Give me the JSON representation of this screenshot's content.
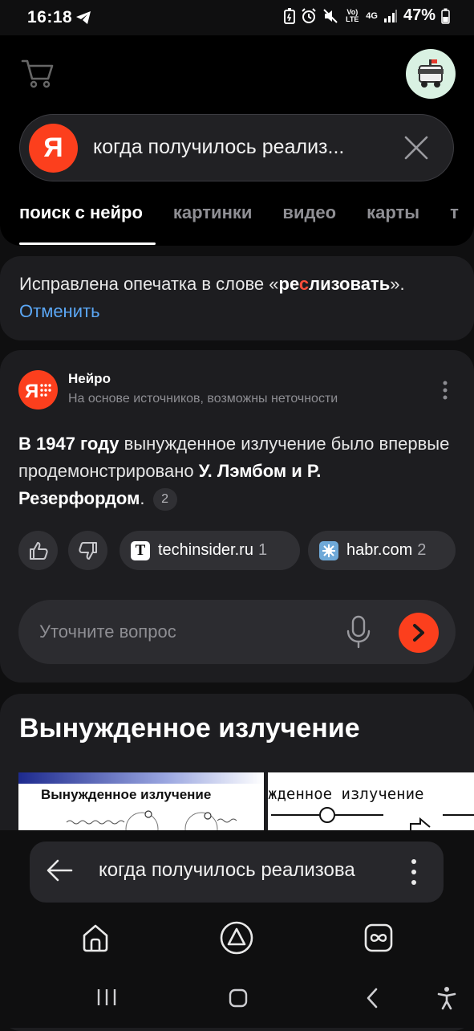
{
  "status_bar": {
    "time": "16:18",
    "battery": "47%",
    "network": "4G",
    "volte": "Vo) LTE"
  },
  "search": {
    "logo": "Я",
    "query": "когда получилось реализ..."
  },
  "tabs": [
    {
      "label": "поиск с нейро",
      "active": true
    },
    {
      "label": "картинки"
    },
    {
      "label": "видео"
    },
    {
      "label": "карты"
    },
    {
      "label": "т"
    }
  ],
  "correction": {
    "prefix": "Исправлена опечатка в слове «",
    "word_part1": "ре",
    "word_hl": "с",
    "word_part2": "лизовать",
    "suffix": "».",
    "undo": "Отменить"
  },
  "neuro": {
    "title": "Нейро",
    "subtitle": "На основе источников, возможны неточности",
    "answer_b1": "В 1947 году",
    "answer_t1": " вынужденное излучение было впервые продемонстрировано ",
    "answer_b2": "У. Лэмбом и Р. Резерфордом",
    "answer_t2": ".",
    "citation": "2",
    "sources": [
      {
        "icon_letter": "T",
        "name": "techinsider.ru",
        "count": "1"
      },
      {
        "name": "habr.com",
        "count": "2"
      }
    ],
    "ask_placeholder": "Уточните вопрос"
  },
  "images": {
    "title": "Вынужденное излучение",
    "thumb1_text": "Вынужденное излучение",
    "thumb2_text": "жденное излучение"
  },
  "url_bar": {
    "text": "когда получилось реализова"
  },
  "colors": {
    "accent": "#fc3f1d",
    "link": "#5ba7f5",
    "card": "#1d1d20"
  }
}
